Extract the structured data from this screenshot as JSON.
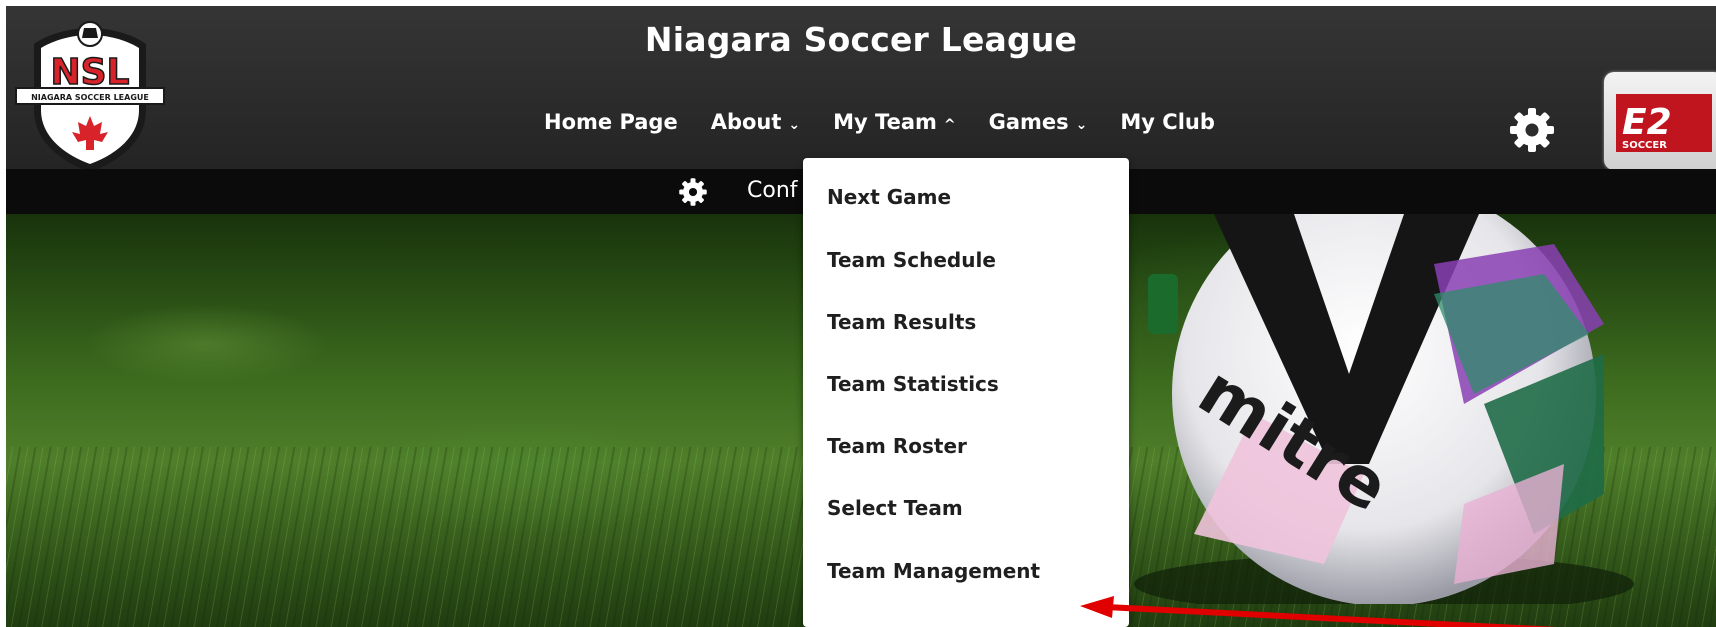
{
  "header": {
    "title": "Niagara Soccer League",
    "logo_text": "NSL",
    "logo_subtext": "NIAGARA SOCCER LEAGUE"
  },
  "nav": {
    "items": [
      {
        "label": "Home Page"
      },
      {
        "label": "About",
        "chevron": "⌄"
      },
      {
        "label": "My Team",
        "chevron": "^"
      },
      {
        "label": "Games",
        "chevron": "⌄"
      },
      {
        "label": "My Club"
      }
    ]
  },
  "sub_bar": {
    "text": "Conf"
  },
  "brand_badge": {
    "text": "E2",
    "subtext": "SOCCER"
  },
  "dropdown": {
    "items": [
      {
        "label": "Next Game"
      },
      {
        "label": "Team Schedule"
      },
      {
        "label": "Team Results"
      },
      {
        "label": "Team Statistics"
      },
      {
        "label": "Team Roster"
      },
      {
        "label": "Select Team"
      },
      {
        "label": "Team Management"
      }
    ]
  },
  "hero": {
    "ball_brand": "mitre"
  },
  "colors": {
    "header_bg": "#2c2c2c",
    "sub_bar_bg": "#0b0b0b",
    "arrow": "#e00000",
    "logo_red": "#d8232a"
  }
}
